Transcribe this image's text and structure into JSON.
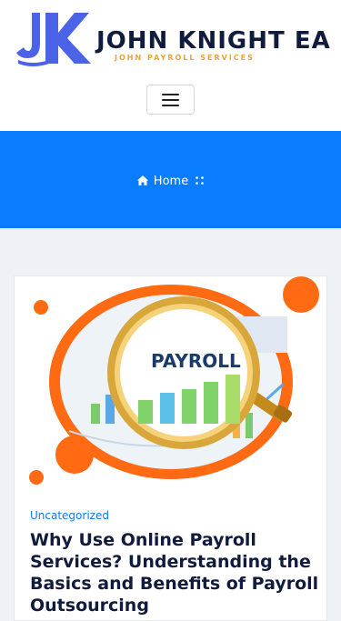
{
  "brand": {
    "name": "JOHN KNIGHT EA",
    "tagline": "JOHN PAYROLL SERVICES",
    "logo_icon": "jk-monogram-icon",
    "colors": {
      "mark": "#4b63e6",
      "name": "#101b3d",
      "tagline": "#e8a33a"
    }
  },
  "nav": {
    "toggle_icon": "hamburger-icon"
  },
  "hero": {
    "background": "#0a7cff",
    "breadcrumb": {
      "home_label": "Home",
      "home_icon": "home-icon",
      "separator_icon": "dots-separator-icon"
    }
  },
  "post": {
    "image_icon": "payroll-magnifier-image",
    "image_text": "PAYROLL",
    "category": "Uncategorized",
    "title": "Why Use Online Payroll Services? Understanding the Basics and Benefits of Payroll Outsourcing",
    "accent": "#ff6a13"
  }
}
